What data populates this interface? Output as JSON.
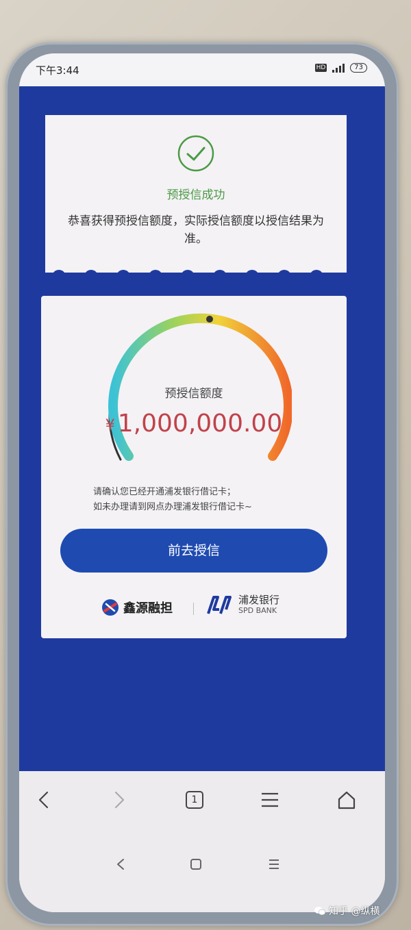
{
  "status_bar": {
    "time": "下午3:44",
    "hd": "HD",
    "battery": "73"
  },
  "result_card": {
    "icon": "check-circle-icon",
    "title": "预授信成功",
    "description": "恭喜获得预授信额度，实际授信额度以授信结果为准。"
  },
  "credit_card": {
    "label": "预授信额度",
    "currency": "¥",
    "amount": "1,000,000.00",
    "notice_line1": "请确认您已经开通浦发银行借记卡；",
    "notice_line2": "如未办理请到网点办理浦发银行借记卡~",
    "cta_label": "前去授信",
    "partner1_name": "鑫源融担",
    "partner2_name": "浦发银行",
    "partner2_en": "SPD BANK"
  },
  "browser_toolbar": {
    "tab_count": "1",
    "icons": [
      "back-arrow-icon",
      "forward-arrow-icon",
      "tabs-icon",
      "menu-icon",
      "home-icon"
    ]
  },
  "system_nav": {
    "icons": [
      "system-back-icon",
      "system-home-icon",
      "system-menu-icon"
    ]
  },
  "watermark": {
    "text": "知乎 @纵横"
  },
  "colors": {
    "page_bg": "#1f3a9f",
    "success_green": "#4b9a45",
    "amount_red": "#c1424a",
    "cta_blue": "#1f4bb0"
  }
}
